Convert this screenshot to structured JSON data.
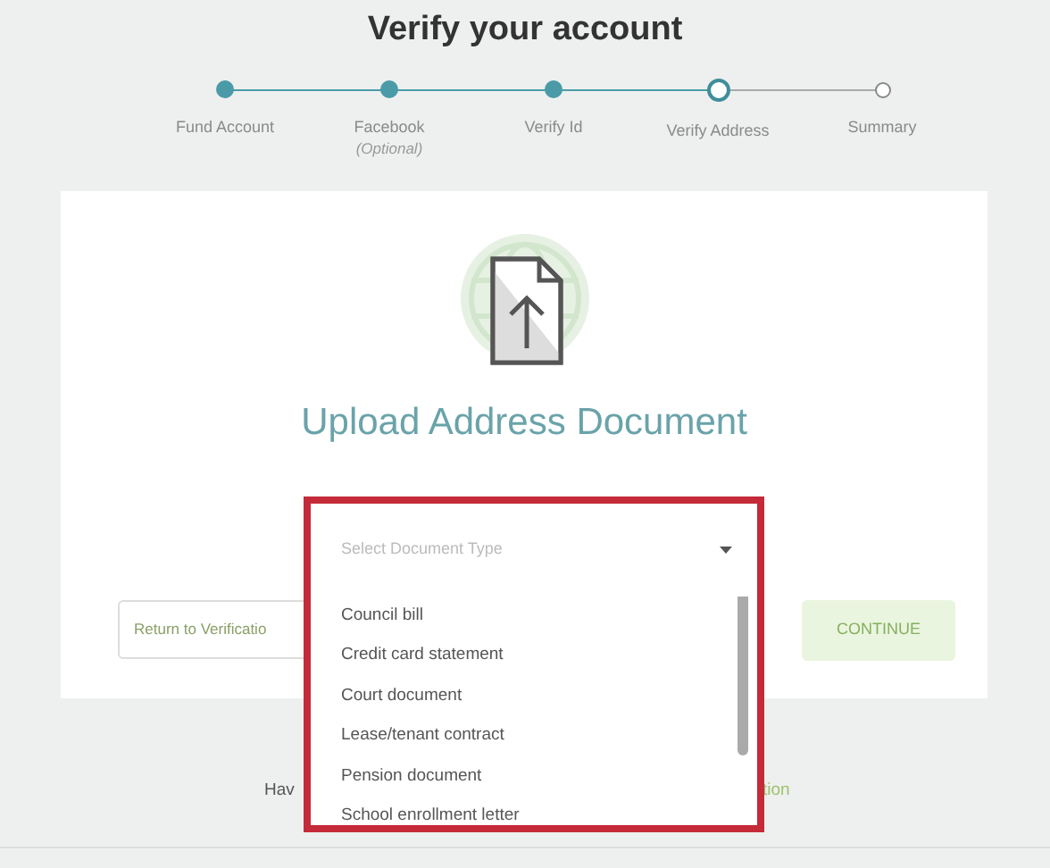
{
  "title": "Verify your account",
  "steps": [
    {
      "label": "Fund Account",
      "completed": true,
      "selected": false
    },
    {
      "label": "Facebook",
      "note": "(Optional)",
      "completed": true,
      "selected": false
    },
    {
      "label": "Verify Id",
      "completed": true,
      "selected": false
    },
    {
      "label": "Verify Address",
      "completed": false,
      "selected": true
    },
    {
      "label": "Summary",
      "completed": false,
      "selected": false
    }
  ],
  "upload": {
    "heading": "Upload Address Document"
  },
  "dropdown": {
    "placeholder": "Select Document Type",
    "expanded": true,
    "options": [
      "Council bill",
      "Credit card statement",
      "Court document",
      "Lease/tenant contract",
      "Pension document",
      "School enrollment letter"
    ]
  },
  "buttons": {
    "back": "Return to Verificatio",
    "continue": {
      "label": "CONTINUE",
      "disabled": true
    }
  },
  "footer": {
    "text_start": "Hav",
    "text_end": "tion"
  }
}
